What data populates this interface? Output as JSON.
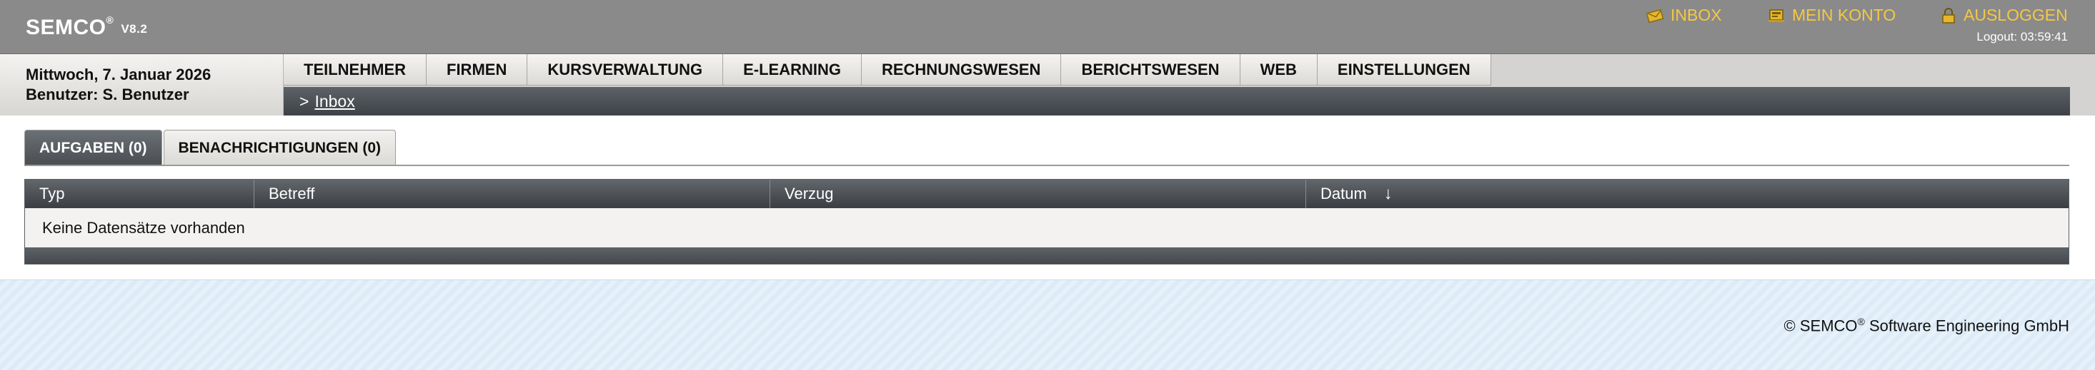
{
  "header": {
    "brand": "SEMCO",
    "brand_mark": "®",
    "version": "V8.2",
    "links": {
      "inbox": "INBOX",
      "account": "MEIN KONTO",
      "logout": "AUSLOGGEN"
    },
    "logout_timer": "Logout: 03:59:41",
    "accent_color": "#f5c842"
  },
  "user": {
    "date": "Mittwoch, 7. Januar 2026",
    "user_line": "Benutzer: S. Benutzer"
  },
  "nav": {
    "items": [
      "TEILNEHMER",
      "FIRMEN",
      "KURSVERWALTUNG",
      "E-LEARNING",
      "RECHNUNGSWESEN",
      "BERICHTSWESEN",
      "WEB",
      "EINSTELLUNGEN"
    ]
  },
  "breadcrumb": {
    "separator": ">",
    "current": "Inbox"
  },
  "tabs": {
    "tasks": "AUFGABEN (0)",
    "notifications": "BENACHRICHTIGUNGEN (0)"
  },
  "table": {
    "columns": [
      "Typ",
      "Betreff",
      "Verzug",
      "Datum"
    ],
    "sort_arrow": "↓",
    "empty_message": "Keine Datensätze vorhanden"
  },
  "footer": {
    "copyright_prefix": "© SEMCO",
    "mark": "®",
    "company": " Software Engineering GmbH"
  }
}
